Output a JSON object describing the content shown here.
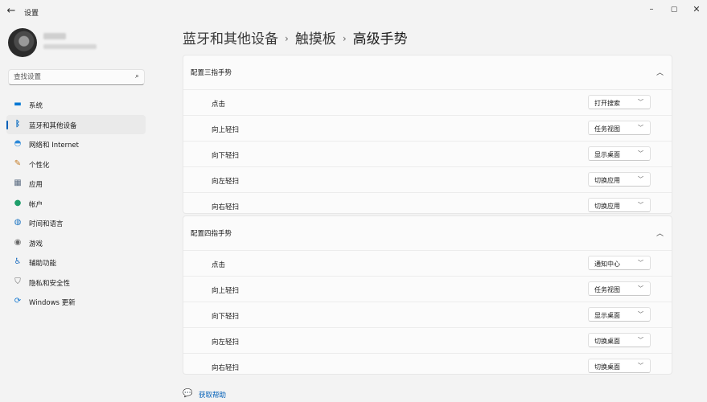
{
  "window": {
    "title": "设置",
    "back_icon": "arrow-left-icon",
    "controls": [
      "minimize-icon",
      "maximize-icon",
      "close-icon"
    ]
  },
  "search": {
    "placeholder": "查找设置",
    "value": ""
  },
  "sidebar": {
    "items": [
      {
        "label": "系统",
        "icon": "monitor-icon",
        "color": "#0078d4"
      },
      {
        "label": "蓝牙和其他设备",
        "icon": "bluetooth-icon",
        "color": "#0067c0",
        "active": true
      },
      {
        "label": "网络和 Internet",
        "icon": "wifi-icon",
        "color": "#2b88d8"
      },
      {
        "label": "个性化",
        "icon": "brush-icon",
        "color": "#c47a22"
      },
      {
        "label": "应用",
        "icon": "apps-icon",
        "color": "#5a6b80"
      },
      {
        "label": "帐户",
        "icon": "person-icon",
        "color": "#1e9e6a"
      },
      {
        "label": "时间和语言",
        "icon": "globe-clock-icon",
        "color": "#1a73c2"
      },
      {
        "label": "游戏",
        "icon": "gamepad-icon",
        "color": "#666666"
      },
      {
        "label": "辅助功能",
        "icon": "accessibility-icon",
        "color": "#1f6fc0"
      },
      {
        "label": "隐私和安全性",
        "icon": "shield-icon",
        "color": "#6b6b6b"
      },
      {
        "label": "Windows 更新",
        "icon": "update-icon",
        "color": "#1679d0"
      }
    ]
  },
  "breadcrumb": {
    "items": [
      "蓝牙和其他设备",
      "触摸板"
    ],
    "current": "高级手势",
    "separator": "›"
  },
  "sections": {
    "three_finger": {
      "title": "配置三指手势",
      "rows": [
        {
          "label": "点击",
          "value": "打开搜索"
        },
        {
          "label": "向上轻扫",
          "value": "任务视图"
        },
        {
          "label": "向下轻扫",
          "value": "显示桌面"
        },
        {
          "label": "向左轻扫",
          "value": "切换应用"
        },
        {
          "label": "向右轻扫",
          "value": "切换应用"
        }
      ]
    },
    "four_finger": {
      "title": "配置四指手势",
      "rows": [
        {
          "label": "点击",
          "value": "通知中心"
        },
        {
          "label": "向上轻扫",
          "value": "任务视图"
        },
        {
          "label": "向下轻扫",
          "value": "显示桌面"
        },
        {
          "label": "向左轻扫",
          "value": "切换桌面"
        },
        {
          "label": "向右轻扫",
          "value": "切换桌面"
        }
      ]
    }
  },
  "help": {
    "label": "获取帮助",
    "icon": "help-chat-icon"
  },
  "accent_color": "#005fb8"
}
